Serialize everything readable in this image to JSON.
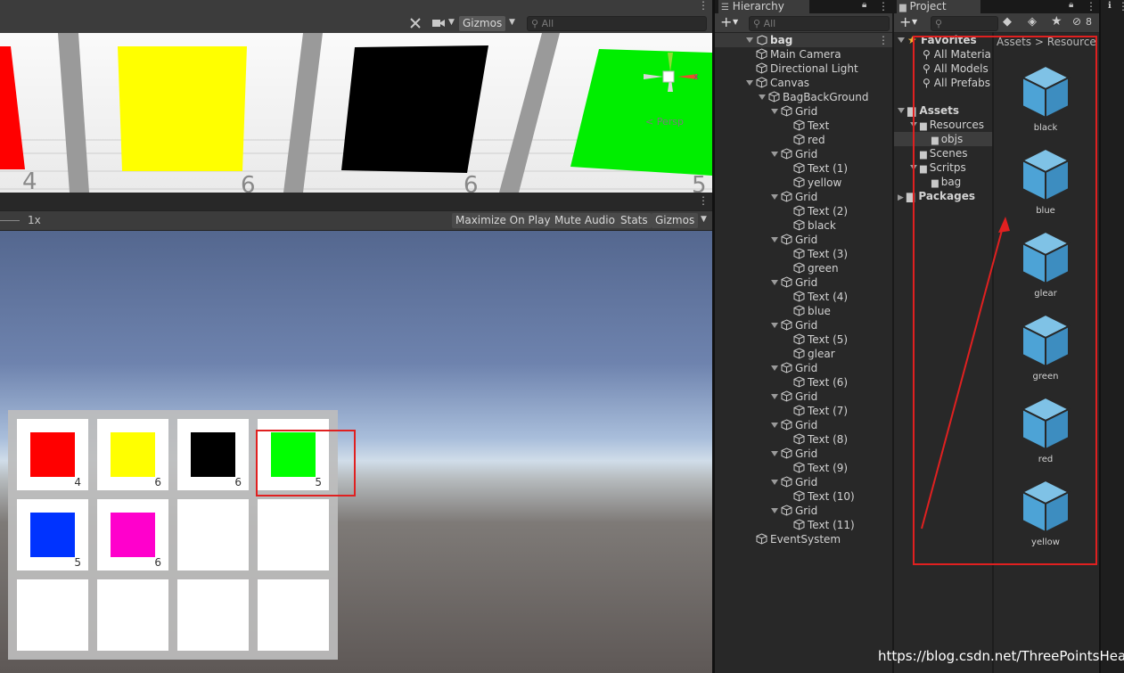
{
  "scene_view": {
    "toolbar": {
      "gizmos_label": "Gizmos",
      "search_placeholder": "All"
    },
    "perspective_label": "< Persp",
    "axis_x": "x",
    "ground_numbers": [
      "4",
      "6",
      "6",
      "5"
    ],
    "colors": {
      "red": "#ff0000",
      "yellow": "#ffff00",
      "black": "#000000",
      "green": "#00ff00"
    }
  },
  "game_view": {
    "toolbar": {
      "scale": "1x",
      "maximize": "Maximize On Play",
      "mute": "Mute Audio",
      "stats": "Stats",
      "gizmos": "Gizmos"
    },
    "inventory": [
      {
        "color": "#ff0000",
        "count": "4"
      },
      {
        "color": "#ffff00",
        "count": "6"
      },
      {
        "color": "#000000",
        "count": "6"
      },
      {
        "color": "#00ff00",
        "count": "5"
      },
      {
        "color": "#0033ff",
        "count": "5"
      },
      {
        "color": "#ff00cc",
        "count": "6"
      }
    ]
  },
  "hierarchy": {
    "tab": "Hierarchy",
    "search_placeholder": "All",
    "root": "bag",
    "items": [
      {
        "label": "Main Camera",
        "depth": 1,
        "arrow": false
      },
      {
        "label": "Directional Light",
        "depth": 1,
        "arrow": false
      },
      {
        "label": "Canvas",
        "depth": 1,
        "arrow": true
      },
      {
        "label": "BagBackGround",
        "depth": 2,
        "arrow": true
      },
      {
        "label": "Grid",
        "depth": 3,
        "arrow": true
      },
      {
        "label": "Text",
        "depth": 4,
        "arrow": false
      },
      {
        "label": "red",
        "depth": 4,
        "arrow": false
      },
      {
        "label": "Grid",
        "depth": 3,
        "arrow": true
      },
      {
        "label": "Text (1)",
        "depth": 4,
        "arrow": false
      },
      {
        "label": "yellow",
        "depth": 4,
        "arrow": false
      },
      {
        "label": "Grid",
        "depth": 3,
        "arrow": true
      },
      {
        "label": "Text (2)",
        "depth": 4,
        "arrow": false
      },
      {
        "label": "black",
        "depth": 4,
        "arrow": false
      },
      {
        "label": "Grid",
        "depth": 3,
        "arrow": true
      },
      {
        "label": "Text (3)",
        "depth": 4,
        "arrow": false
      },
      {
        "label": "green",
        "depth": 4,
        "arrow": false
      },
      {
        "label": "Grid",
        "depth": 3,
        "arrow": true
      },
      {
        "label": "Text (4)",
        "depth": 4,
        "arrow": false
      },
      {
        "label": "blue",
        "depth": 4,
        "arrow": false
      },
      {
        "label": "Grid",
        "depth": 3,
        "arrow": true
      },
      {
        "label": "Text (5)",
        "depth": 4,
        "arrow": false
      },
      {
        "label": "glear",
        "depth": 4,
        "arrow": false
      },
      {
        "label": "Grid",
        "depth": 3,
        "arrow": true
      },
      {
        "label": "Text (6)",
        "depth": 4,
        "arrow": false
      },
      {
        "label": "Grid",
        "depth": 3,
        "arrow": true
      },
      {
        "label": "Text (7)",
        "depth": 4,
        "arrow": false
      },
      {
        "label": "Grid",
        "depth": 3,
        "arrow": true
      },
      {
        "label": "Text (8)",
        "depth": 4,
        "arrow": false
      },
      {
        "label": "Grid",
        "depth": 3,
        "arrow": true
      },
      {
        "label": "Text (9)",
        "depth": 4,
        "arrow": false
      },
      {
        "label": "Grid",
        "depth": 3,
        "arrow": true
      },
      {
        "label": "Text (10)",
        "depth": 4,
        "arrow": false
      },
      {
        "label": "Grid",
        "depth": 3,
        "arrow": true
      },
      {
        "label": "Text (11)",
        "depth": 4,
        "arrow": false
      },
      {
        "label": "EventSystem",
        "depth": 1,
        "arrow": false
      }
    ]
  },
  "project": {
    "tab": "Project",
    "hidden_count": "8",
    "favorites_label": "Favorites",
    "favorites": [
      "All Materia",
      "All Models",
      "All Prefabs"
    ],
    "assets_label": "Assets",
    "tree": [
      {
        "label": "Resources",
        "depth": 1,
        "open": true
      },
      {
        "label": "objs",
        "depth": 2,
        "open": false
      },
      {
        "label": "Scenes",
        "depth": 1,
        "open": false
      },
      {
        "label": "Scritps",
        "depth": 1,
        "open": true
      },
      {
        "label": "bag",
        "depth": 2,
        "open": false
      }
    ],
    "packages_label": "Packages",
    "breadcrumb": [
      "Assets",
      "Resources"
    ],
    "assets": [
      "black",
      "blue",
      "glear",
      "green",
      "red",
      "yellow"
    ]
  },
  "watermark": "https://blog.csdn.net/ThreePointsHeat",
  "annotation_color": "#e02020"
}
